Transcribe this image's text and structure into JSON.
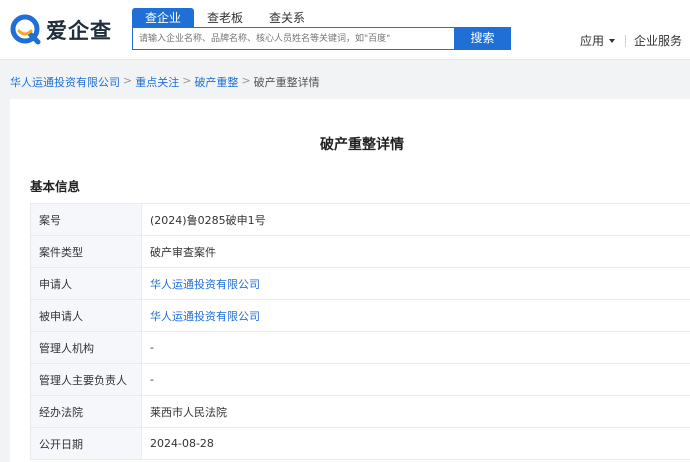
{
  "header": {
    "brand": "爱企查",
    "tabs": [
      {
        "label": "查企业",
        "active": true
      },
      {
        "label": "查老板",
        "active": false
      },
      {
        "label": "查关系",
        "active": false
      }
    ],
    "search": {
      "placeholder": "请输入企业名称、品牌名称、核心人员姓名等关键词，如\"百度\"",
      "button_label": "搜索"
    },
    "nav": {
      "app_label": "应用",
      "service_label": "企业服务"
    }
  },
  "breadcrumb": {
    "links": [
      "华人运通投资有限公司",
      "重点关注",
      "破产重整"
    ],
    "current": "破产重整详情",
    "separator": ">"
  },
  "page": {
    "title": "破产重整详情",
    "section_title": "基本信息",
    "rows": [
      {
        "label": "案号",
        "value": "(2024)鲁0285破申1号",
        "link": false
      },
      {
        "label": "案件类型",
        "value": "破产审查案件",
        "link": false
      },
      {
        "label": "申请人",
        "value": "华人运通投资有限公司",
        "link": true
      },
      {
        "label": "被申请人",
        "value": "华人运通投资有限公司",
        "link": true
      },
      {
        "label": "管理人机构",
        "value": "-",
        "link": false
      },
      {
        "label": "管理人主要负责人",
        "value": "-",
        "link": false
      },
      {
        "label": "经办法院",
        "value": "莱西市人民法院",
        "link": false
      },
      {
        "label": "公开日期",
        "value": "2024-08-28",
        "link": false
      }
    ]
  },
  "colors": {
    "accent": "#1f6fd6",
    "logo_orange": "#f5a623"
  }
}
